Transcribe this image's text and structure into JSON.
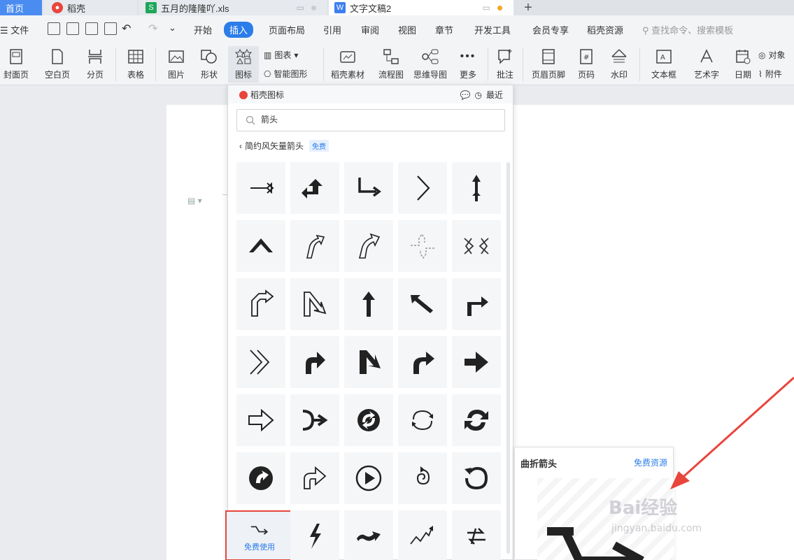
{
  "tabs": {
    "home": "首页",
    "docer": "稻壳",
    "xls": "五月的隆隆吖.xls",
    "doc": "文字文稿2",
    "new_tab": "+"
  },
  "menu": {
    "file": "文件",
    "items": [
      "开始",
      "插入",
      "页面布局",
      "引用",
      "审阅",
      "视图",
      "章节",
      "开发工具",
      "会员专享",
      "稻壳资源"
    ],
    "active": "插入",
    "search_placeholder": "查找命令、搜索模板"
  },
  "ribbon": {
    "cover": "封面页",
    "blank": "空白页",
    "pagebreak": "分页",
    "table": "表格",
    "picture": "图片",
    "shape": "形状",
    "icon": "图标",
    "chart": "图表",
    "smartart": "智能图形",
    "docer_material": "稻壳素材",
    "flowchart": "流程图",
    "mindmap": "思维导图",
    "more": "更多",
    "comment": "批注",
    "header_footer": "页眉页脚",
    "page_number": "页码",
    "watermark": "水印",
    "textbox": "文本框",
    "wordart": "艺术字",
    "date": "日期",
    "object": "对象",
    "attachment": "附件"
  },
  "panel": {
    "title": "稻壳图标",
    "recent": "最近",
    "search_value": "箭头",
    "category": "简约风矢量箭头",
    "free_badge": "免费",
    "use_free": "免费使用"
  },
  "icons": [
    "arrow-right-outline",
    "arrow-turn-up-left",
    "arrow-down-right",
    "chevron-right",
    "arrow-up-double",
    "chevron-up",
    "curved-arrow-up-outline",
    "curved-arrow-up-outline-2",
    "arrows-split-dotted",
    "arrows-converge",
    "arrow-turn-outline",
    "arrow-zigzag-down-right",
    "arrow-up-solid",
    "arrow-up-left",
    "arrow-turn-right-up",
    "double-chevron-right",
    "arrow-up-right-bold",
    "arrow-down-right-bold",
    "arrow-curve-up-right",
    "arrow-right-bold",
    "arrow-right-hollow",
    "arrow-merge-right",
    "circle-arrows-solid",
    "circle-arrows-cycle",
    "refresh-arrows",
    "circle-arrow-filled",
    "arrow-share-outline",
    "play-circle",
    "spiral-arrow",
    "rotate-arrow",
    "arrow-bent-right",
    "lightning-arrow",
    "wave-arrow",
    "zigzag-arrow",
    "swap-arrows"
  ],
  "preview": {
    "title": "曲折箭头",
    "free_resource": "免费资源"
  },
  "watermark": {
    "brand": "Bai经验",
    "url": "jingyan.baidu.com"
  },
  "colors": {
    "accent": "#2b7de9",
    "highlight_red": "#e8453c"
  }
}
